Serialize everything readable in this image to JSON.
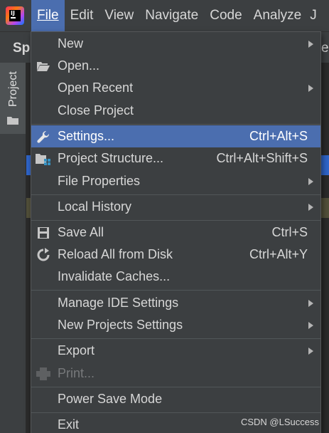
{
  "menubar": {
    "items": [
      {
        "label": "File"
      },
      {
        "label": "Edit"
      },
      {
        "label": "View"
      },
      {
        "label": "Navigate"
      },
      {
        "label": "Code"
      },
      {
        "label": "Analyze"
      }
    ],
    "truncated_right": "J"
  },
  "subbar": {
    "left_fragment": "Sp",
    "right_fragment": "e"
  },
  "toolwindow": {
    "project_tab_label": "Project"
  },
  "file_menu": {
    "items": {
      "new": {
        "label": "New"
      },
      "open": {
        "label": "Open..."
      },
      "open_recent": {
        "label": "Open Recent"
      },
      "close_project": {
        "label": "Close Project"
      },
      "settings": {
        "label": "Settings...",
        "shortcut": "Ctrl+Alt+S"
      },
      "project_structure": {
        "label": "Project Structure...",
        "shortcut": "Ctrl+Alt+Shift+S"
      },
      "file_properties": {
        "label": "File Properties"
      },
      "local_history": {
        "label": "Local History"
      },
      "save_all": {
        "label": "Save All",
        "shortcut": "Ctrl+S"
      },
      "reload_all": {
        "label": "Reload All from Disk",
        "shortcut": "Ctrl+Alt+Y"
      },
      "invalidate_caches": {
        "label": "Invalidate Caches..."
      },
      "manage_ide_settings": {
        "label": "Manage IDE Settings"
      },
      "new_projects_settings": {
        "label": "New Projects Settings"
      },
      "export": {
        "label": "Export"
      },
      "print": {
        "label": "Print..."
      },
      "power_save_mode": {
        "label": "Power Save Mode"
      },
      "exit": {
        "label": "Exit"
      }
    }
  },
  "watermark": "CSDN @LSuccess",
  "colors": {
    "background": "#3c3f41",
    "selection": "#4b6eaf",
    "disabled_text": "#77797b",
    "text": "#d7d7d7"
  }
}
